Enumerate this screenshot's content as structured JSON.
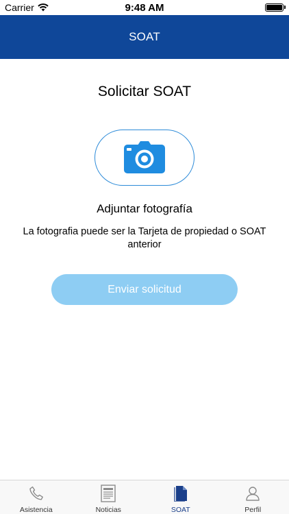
{
  "status_bar": {
    "carrier": "Carrier",
    "time": "9:48 AM"
  },
  "nav": {
    "title": "SOAT"
  },
  "main": {
    "title": "Solicitar SOAT",
    "camera_icon": "camera-icon",
    "attach_label": "Adjuntar fotografía",
    "attach_hint": "La fotografia puede ser la Tarjeta de propiedad o SOAT anterior",
    "submit_label": "Enviar solicitud"
  },
  "tabs": [
    {
      "label": "Asistencia",
      "icon": "phone-icon"
    },
    {
      "label": "Noticias",
      "icon": "newspaper-icon"
    },
    {
      "label": "SOAT",
      "icon": "document-icon",
      "active": true
    },
    {
      "label": "Perfil",
      "icon": "user-icon"
    }
  ],
  "colors": {
    "nav": "#0f4799",
    "accent": "#1f8ce0",
    "button_disabled": "#8ecdf3",
    "active_tab": "#1a3f8a"
  }
}
